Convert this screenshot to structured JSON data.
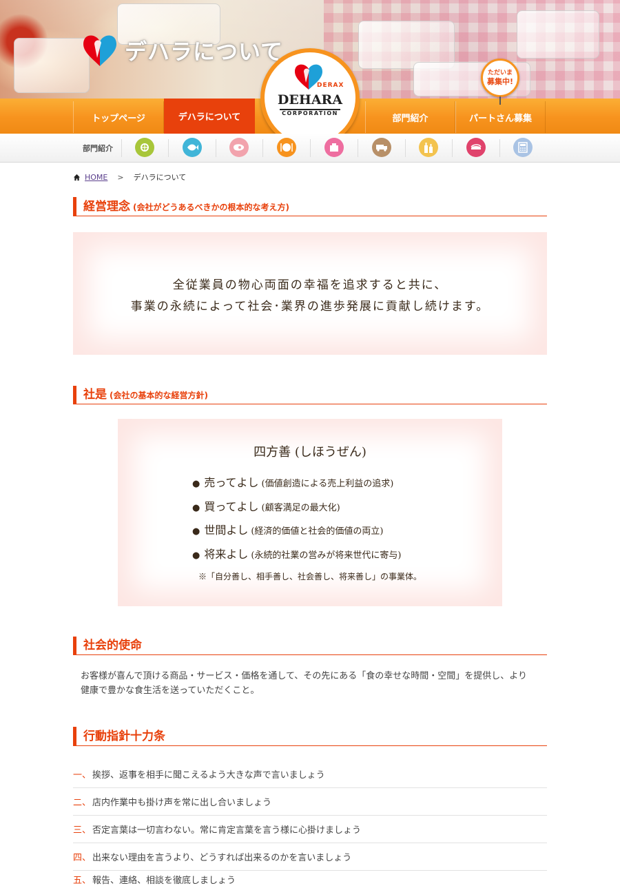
{
  "hero": {
    "title": "デハラについて"
  },
  "badge": {
    "line1": "ただいま",
    "line2": "募集中!"
  },
  "logo": {
    "derax": "DERAX",
    "dehara": "DEHARA",
    "corporation": "CORPORATION"
  },
  "nav": {
    "items": [
      {
        "label": "トップページ"
      },
      {
        "label": "デハラについて"
      },
      {
        "label": "部門紹介"
      },
      {
        "label": "パートさん募集"
      }
    ]
  },
  "dept_bar": {
    "label": "部門紹介",
    "icons": [
      {
        "name": "produce-icon",
        "color": "#a8c63a"
      },
      {
        "name": "fish-icon",
        "color": "#41b5d8"
      },
      {
        "name": "meat-icon",
        "color": "#f2a3ad"
      },
      {
        "name": "deli-icon",
        "color": "#f7931e"
      },
      {
        "name": "daily-goods-icon",
        "color": "#ee6ea0"
      },
      {
        "name": "delivery-icon",
        "color": "#b89068"
      },
      {
        "name": "bottles-icon",
        "color": "#f3c34f"
      },
      {
        "name": "sushi-icon",
        "color": "#e0436c"
      },
      {
        "name": "calculator-icon",
        "color": "#a9c3e4"
      }
    ]
  },
  "breadcrumb": {
    "home": "HOME",
    "separator": ">",
    "current": "デハラについて"
  },
  "philosophy": {
    "title": "経営理念",
    "subtitle": "(会社がどうあるべきかの根本的な考え方)",
    "lines": [
      "全従業員の物心両面の幸福を追求すると共に、",
      "事業の永続によって社会･業界の進歩発展に貢献し続けます。"
    ]
  },
  "creed": {
    "title": "社是",
    "subtitle": "(会社の基本的な経営方針)",
    "box_title": "四方善 (しほうぜん)",
    "items": [
      {
        "main": "売ってよし",
        "detail": "(価値創造による売上利益の追求)"
      },
      {
        "main": "買ってよし",
        "detail": "(顧客満足の最大化)"
      },
      {
        "main": "世間よし",
        "detail": "(経済的価値と社会的価値の両立)"
      },
      {
        "main": "将来よし",
        "detail": "(永続的社業の営みが将来世代に寄与)"
      }
    ],
    "note": "※「自分善し、相手善し、社会善し、将来善し」の事業体。"
  },
  "mission": {
    "title": "社会的使命",
    "text": "お客様が喜んで頂ける商品・サービス・価格を通して、その先にある「食の幸せな時間・空間」を提供し、より健康で豊かな食生活を送っていただくこと。"
  },
  "rules": {
    "title": "行動指針十力条",
    "items": [
      {
        "num": "一、",
        "text": "挨拶、返事を相手に聞こえるよう大きな声で言いましょう"
      },
      {
        "num": "二、",
        "text": "店内作業中も掛け声を常に出し合いましょう"
      },
      {
        "num": "三、",
        "text": "否定言葉は一切言わない。常に肯定言葉を言う様に心掛けましょう"
      },
      {
        "num": "四、",
        "text": "出来ない理由を言うより、どうすれば出来るのかを言いましょう"
      },
      {
        "num": "五、",
        "text": "報告、連絡、相談を徹底しましょう"
      }
    ]
  }
}
